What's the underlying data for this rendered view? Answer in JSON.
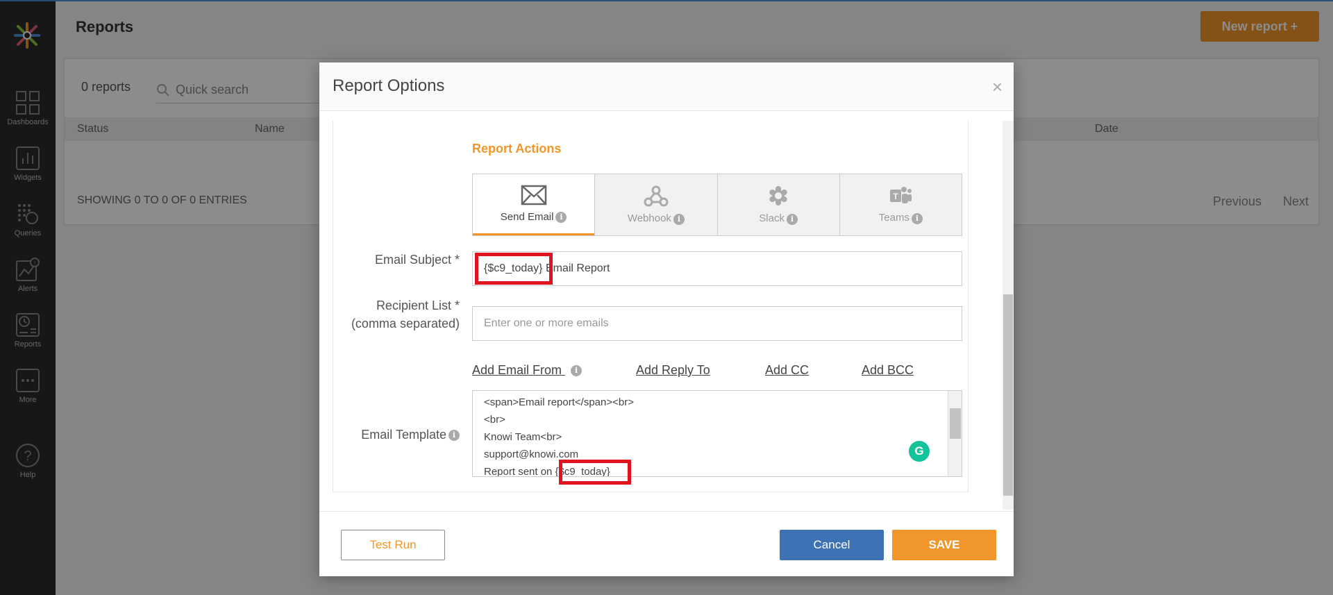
{
  "sidebar": {
    "items": [
      {
        "label": "Dashboards",
        "icon": "dashboard-grid-icon"
      },
      {
        "label": "Widgets",
        "icon": "bar-chart-icon"
      },
      {
        "label": "Queries",
        "icon": "query-dots-icon"
      },
      {
        "label": "Alerts",
        "icon": "alert-chart-icon"
      },
      {
        "label": "Reports",
        "icon": "report-clock-icon"
      },
      {
        "label": "More",
        "icon": "more-dots-icon"
      },
      {
        "label": "Help",
        "icon": "help-question-icon"
      }
    ]
  },
  "page": {
    "title": "Reports",
    "new_report": "New report +",
    "count": "0 reports",
    "search_placeholder": "Quick search",
    "columns": [
      "Status",
      "Name",
      "Date"
    ],
    "showing": "SHOWING 0 TO 0 OF 0 ENTRIES",
    "prev": "Previous",
    "next": "Next"
  },
  "modal": {
    "title": "Report Options",
    "close": "×",
    "section_title": "Report Actions",
    "actions": [
      "Send Email",
      "Webhook",
      "Slack",
      "Teams"
    ],
    "subject_label": "Email Subject *",
    "subject_value": "{$c9_today} Email Report",
    "recipient_label_1": "Recipient List *",
    "recipient_label_2": "(comma separated)",
    "recipient_placeholder": "Enter one or more emails",
    "links": [
      "Add Email From",
      "Add Reply To",
      "Add CC",
      "Add BCC"
    ],
    "template_label": "Email Template",
    "template_lines": [
      "<span>Email report</span><br>",
      "<br>",
      "Knowi Team<br>",
      "support@knowi.com",
      "Report sent on {$c9_today}"
    ],
    "grammarly": "G",
    "test_run": "Test Run",
    "cancel": "Cancel",
    "save": "SAVE"
  },
  "colors": {
    "accent": "#f0962a",
    "primary": "#3d72b4",
    "highlight": "#e0141e"
  }
}
